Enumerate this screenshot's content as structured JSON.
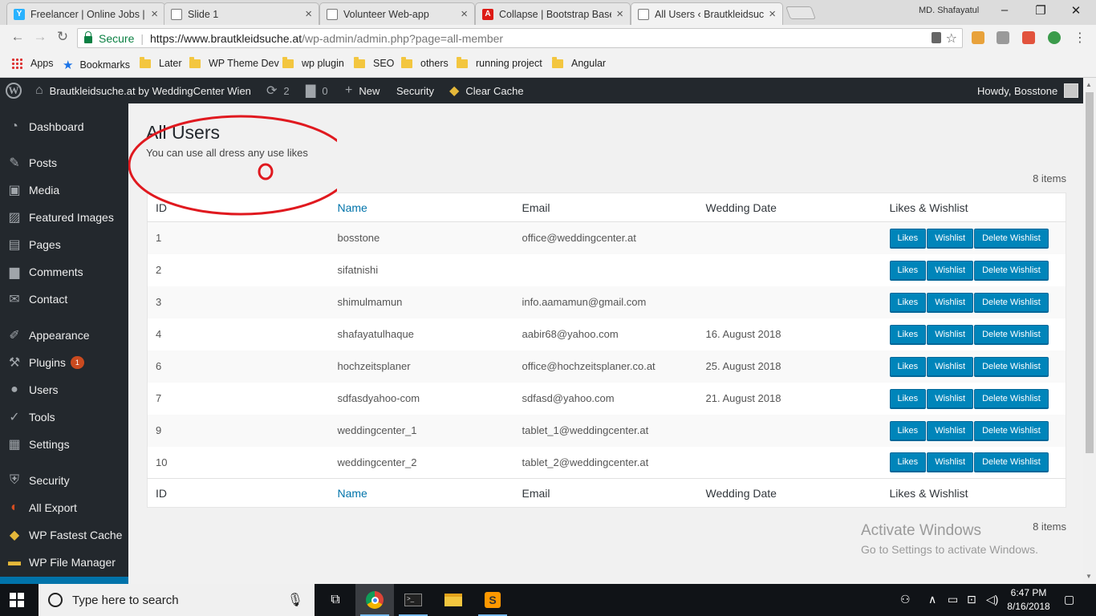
{
  "browser": {
    "tabs": [
      {
        "title": "Freelancer | Online Jobs |",
        "icon": "freelancer-icon"
      },
      {
        "title": "Slide 1",
        "icon": "page-icon"
      },
      {
        "title": "Volunteer Web-app",
        "icon": "page-icon"
      },
      {
        "title": "Collapse | Bootstrap Base",
        "icon": "angular-icon"
      },
      {
        "title": "All Users ‹ Brautkleidsuch",
        "icon": "page-icon"
      }
    ],
    "profile_name": "MD. Shafayatul",
    "secure_label": "Secure",
    "url_host": "https://www.brautkleidsuche.at",
    "url_path": "/wp-admin/admin.php?page=all-member"
  },
  "bookmarks": [
    {
      "label": "Apps",
      "icon": "apps-grid-icon"
    },
    {
      "label": "Bookmarks",
      "icon": "star-icon"
    },
    {
      "label": "Later",
      "icon": "folder-icon"
    },
    {
      "label": "WP Theme Dev",
      "icon": "folder-icon"
    },
    {
      "label": "wp plugin",
      "icon": "folder-icon"
    },
    {
      "label": "SEO",
      "icon": "folder-icon"
    },
    {
      "label": "others",
      "icon": "folder-icon"
    },
    {
      "label": "running project",
      "icon": "folder-icon"
    },
    {
      "label": "Angular",
      "icon": "folder-icon"
    }
  ],
  "adminbar": {
    "site_name": "Brautkleidsuche.at by WeddingCenter Wien",
    "updates_count": "2",
    "comments_count": "0",
    "new_label": "New",
    "security_label": "Security",
    "clear_cache_label": "Clear Cache",
    "howdy": "Howdy, Bosstone"
  },
  "sidebar": {
    "items": [
      {
        "label": "Dashboard",
        "icon": "dashboard-icon"
      },
      {
        "label": "Posts",
        "icon": "pushpin-icon"
      },
      {
        "label": "Media",
        "icon": "media-icon"
      },
      {
        "label": "Featured Images",
        "icon": "images-icon"
      },
      {
        "label": "Pages",
        "icon": "pages-icon"
      },
      {
        "label": "Comments",
        "icon": "comment-icon"
      },
      {
        "label": "Contact",
        "icon": "mail-icon"
      },
      {
        "label": "Appearance",
        "icon": "brush-icon"
      },
      {
        "label": "Plugins",
        "icon": "plugin-icon",
        "badge": "1"
      },
      {
        "label": "Users",
        "icon": "user-icon"
      },
      {
        "label": "Tools",
        "icon": "wrench-icon"
      },
      {
        "label": "Settings",
        "icon": "settings-icon"
      },
      {
        "label": "Security",
        "icon": "shield-icon"
      },
      {
        "label": "All Export",
        "icon": "export-icon"
      },
      {
        "label": "WP Fastest Cache",
        "icon": "cheetah-icon"
      },
      {
        "label": "WP File Manager",
        "icon": "folder-icon"
      }
    ]
  },
  "page": {
    "title": "All Users",
    "subtitle": "You can use all dress any use likes",
    "items_count": "8 items"
  },
  "table": {
    "columns": [
      "ID",
      "Name",
      "Email",
      "Wedding Date",
      "Likes & Wishlist"
    ],
    "rows": [
      {
        "id": "1",
        "name": "bosstone",
        "email": "office@weddingcenter.at",
        "date": ""
      },
      {
        "id": "2",
        "name": "sifatnishi",
        "email": "",
        "date": ""
      },
      {
        "id": "3",
        "name": "shimulmamun",
        "email": "info.aamamun@gmail.com",
        "date": ""
      },
      {
        "id": "4",
        "name": "shafayatulhaque",
        "email": "aabir68@yahoo.com",
        "date": "16. August 2018"
      },
      {
        "id": "6",
        "name": "hochzeitsplaner",
        "email": "office@hochzeitsplaner.co.at",
        "date": "25. August 2018"
      },
      {
        "id": "7",
        "name": "sdfasdyahoo-com",
        "email": "sdfasd@yahoo.com",
        "date": "21. August 2018"
      },
      {
        "id": "9",
        "name": "weddingcenter_1",
        "email": "tablet_1@weddingcenter.at",
        "date": ""
      },
      {
        "id": "10",
        "name": "weddingcenter_2",
        "email": "tablet_2@weddingcenter.at",
        "date": ""
      }
    ],
    "buttons": {
      "likes": "Likes",
      "wishlist": "Wishlist",
      "delete": "Delete Wishlist"
    }
  },
  "watermark": {
    "title": "Activate Windows",
    "subtitle": "Go to Settings to activate Windows."
  },
  "taskbar": {
    "search_placeholder": "Type here to search",
    "time": "6:47 PM",
    "date": "8/16/2018"
  },
  "colors": {
    "admin_bar": "#23282d",
    "accent": "#0073aa",
    "button": "#0085ba",
    "annotation": "#e0191f"
  }
}
